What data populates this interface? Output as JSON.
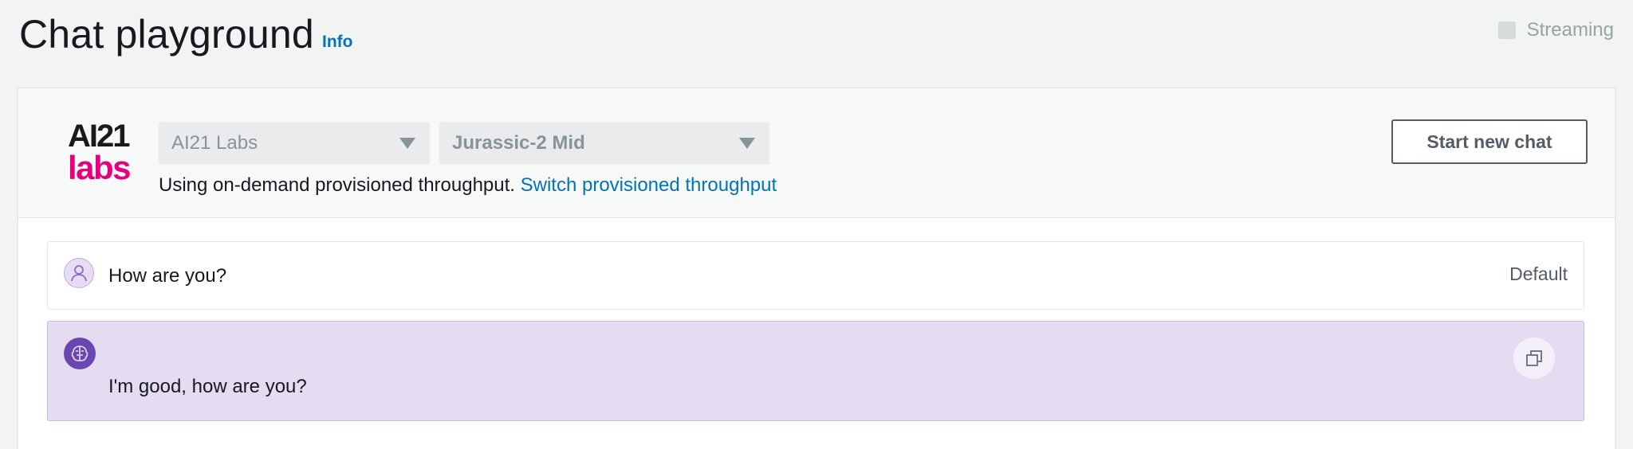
{
  "page": {
    "title": "Chat playground",
    "info_label": "Info"
  },
  "streaming": {
    "label": "Streaming",
    "checked": false
  },
  "provider": {
    "logo_top": "AI21",
    "logo_bottom": "labs",
    "logo_colors": {
      "top": "#1a1a1a",
      "bottom": "#e6007e"
    },
    "provider_select": "AI21 Labs",
    "model_select": "Jurassic-2 Mid"
  },
  "throughput": {
    "text": "Using on-demand provisioned throughput.",
    "link": "Switch provisioned throughput"
  },
  "actions": {
    "start_new_chat": "Start new chat"
  },
  "messages": [
    {
      "role": "user",
      "text": "How are you?",
      "tag": "Default",
      "icon": "user-icon"
    },
    {
      "role": "assistant",
      "text": "I'm good, how are you?",
      "icon": "brain-icon",
      "action_icon": "copy-icon"
    }
  ],
  "colors": {
    "link": "#0073bb",
    "assistant_bg": "#e6dcf1",
    "assistant_avatar": "#6a46b0"
  }
}
